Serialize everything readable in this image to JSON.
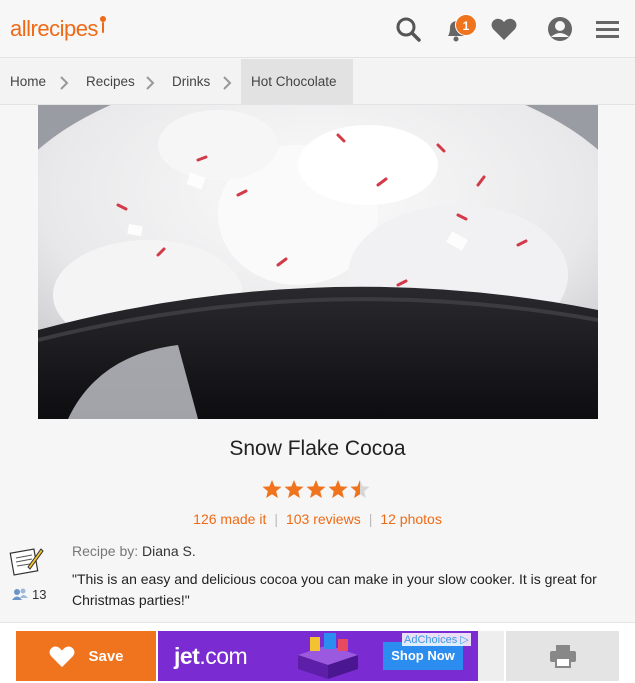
{
  "header": {
    "logo_text": "allrecipes",
    "notification_count": "1",
    "icons": [
      "search-icon",
      "bell-icon",
      "heart-icon",
      "profile-icon",
      "menu-icon"
    ]
  },
  "breadcrumb": {
    "items": [
      "Home",
      "Recipes",
      "Drinks",
      "Hot Chocolate"
    ]
  },
  "recipe": {
    "title": "Snow Flake Cocoa",
    "rating": 4.5,
    "made_it": "126 made it",
    "reviews": "103 reviews",
    "photos": "12 photos",
    "recipe_by_label": "Recipe by:",
    "author": "Diana S.",
    "cook_count": "13",
    "description": "\"This is an easy and delicious cocoa you can make in your slow cooker. It is great for Christmas parties!\""
  },
  "actions": {
    "save_label": "Save"
  },
  "ad": {
    "brand": "jet",
    "brand_suffix": ".com",
    "cta": "Shop Now",
    "adchoices": "AdChoices"
  },
  "colors": {
    "accent": "#f0731e",
    "ad_purple": "#7a2bd1",
    "ad_button": "#2c8df0"
  }
}
